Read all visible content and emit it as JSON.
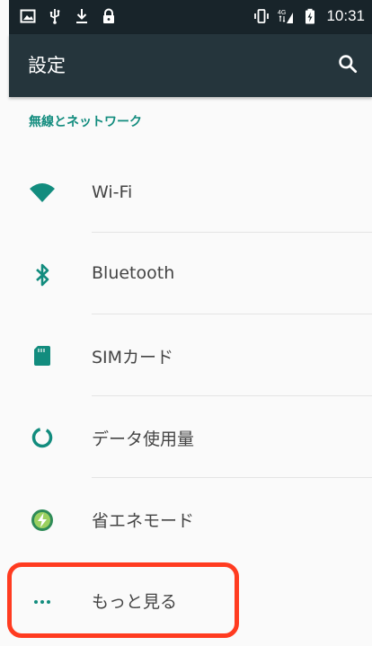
{
  "status_bar": {
    "time": "10:31",
    "network": "4G",
    "left_icons": [
      "image-icon",
      "usb-icon",
      "download-icon",
      "lock-icon"
    ],
    "right_icons": [
      "vibrate-icon",
      "signal-4g-icon",
      "battery-charging-icon"
    ]
  },
  "appbar": {
    "title": "設定",
    "search_icon": "search-icon",
    "color": "#25353c"
  },
  "section": {
    "header": "無線とネットワーク",
    "header_color": "#128c7e"
  },
  "items": [
    {
      "label": "Wi-Fi",
      "icon": "wifi-icon"
    },
    {
      "label": "Bluetooth",
      "icon": "bluetooth-icon"
    },
    {
      "label": "SIMカード",
      "icon": "sim-card-icon"
    },
    {
      "label": "データ使用量",
      "icon": "data-usage-icon"
    },
    {
      "label": "省エネモード",
      "icon": "power-saving-icon"
    },
    {
      "label": "もっと見る",
      "icon": "more-icon"
    }
  ],
  "accent_color": "#128c7e",
  "highlight_color": "#ff3b20"
}
